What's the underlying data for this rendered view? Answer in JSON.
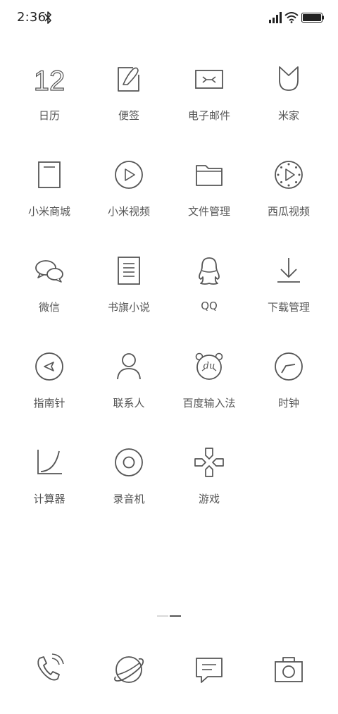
{
  "status_bar": {
    "time": "2:36",
    "bluetooth_icon": "bluetooth-icon",
    "signal_icon": "signal-icon",
    "wifi_icon": "wifi-icon",
    "battery_icon": "battery-icon"
  },
  "apps": [
    {
      "label": "日历",
      "icon": "calendar-icon",
      "icon_text": "12"
    },
    {
      "label": "便签",
      "icon": "notes-icon"
    },
    {
      "label": "电子邮件",
      "icon": "email-icon"
    },
    {
      "label": "米家",
      "icon": "mijia-icon"
    },
    {
      "label": "小米商城",
      "icon": "mi-store-icon"
    },
    {
      "label": "小米视频",
      "icon": "mi-video-icon"
    },
    {
      "label": "文件管理",
      "icon": "folder-icon"
    },
    {
      "label": "西瓜视频",
      "icon": "xigua-video-icon"
    },
    {
      "label": "微信",
      "icon": "wechat-icon"
    },
    {
      "label": "书旗小说",
      "icon": "novel-icon"
    },
    {
      "label": "QQ",
      "icon": "qq-icon"
    },
    {
      "label": "下载管理",
      "icon": "download-icon"
    },
    {
      "label": "指南针",
      "icon": "compass-icon"
    },
    {
      "label": "联系人",
      "icon": "contacts-icon"
    },
    {
      "label": "百度输入法",
      "icon": "baidu-ime-icon",
      "icon_text": "du"
    },
    {
      "label": "时钟",
      "icon": "clock-icon"
    },
    {
      "label": "计算器",
      "icon": "calculator-icon"
    },
    {
      "label": "录音机",
      "icon": "recorder-icon"
    },
    {
      "label": "游戏",
      "icon": "game-icon"
    }
  ],
  "dock": [
    {
      "icon": "phone-icon"
    },
    {
      "icon": "browser-icon"
    },
    {
      "icon": "messages-icon"
    },
    {
      "icon": "camera-icon"
    }
  ],
  "colors": {
    "icon_stroke": "#555555",
    "label": "#555555",
    "background": "#ffffff"
  }
}
